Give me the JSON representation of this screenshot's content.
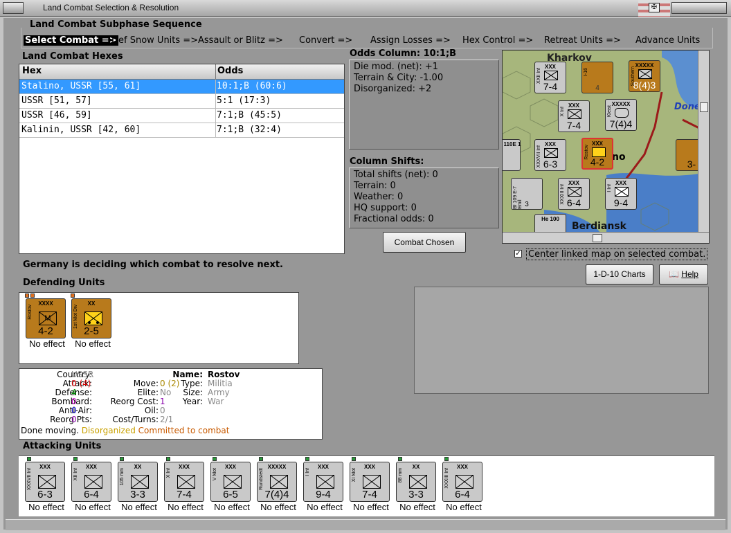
{
  "window": {
    "title": "Land Combat Selection & Resolution"
  },
  "sequence": {
    "header": "Land Combat Subphase Sequence",
    "steps": [
      "Select Combat =>",
      "Def Snow Units =>",
      "Assault or Blitz =>",
      "Convert =>",
      "Assign Losses =>",
      "Hex Control =>",
      "Retreat Units =>",
      "Advance Units"
    ]
  },
  "hexes": {
    "header": "Land Combat Hexes",
    "columns": [
      "Hex",
      "Odds"
    ],
    "rows": [
      {
        "hex": "Stalino, USSR [55, 61]",
        "odds": "10:1;B (60:6)"
      },
      {
        "hex": "USSR [51, 57]",
        "odds": "5:1 (17:3)"
      },
      {
        "hex": "USSR [46, 59]",
        "odds": "7:1;B (45:5)"
      },
      {
        "hex": "Kalinin, USSR [42, 60]",
        "odds": "7:1;B (32:4)"
      }
    ]
  },
  "odds": {
    "header": "Odds Column: 10:1;B",
    "lines": [
      "Die mod. (net): +1",
      "Terrain & City: -1.00",
      "Disorganized: +2"
    ]
  },
  "shifts": {
    "header": "Column Shifts:",
    "lines": [
      "Total shifts (net): 0",
      "Terrain: 0",
      "Weather: 0",
      "HQ support: 0",
      "Fractional odds: 0"
    ]
  },
  "buttons": {
    "combat_chosen": "Combat Chosen",
    "charts": "1-D-10 Charts",
    "help": "Help"
  },
  "center_map": {
    "label": "Center linked map on selected combat.",
    "checked": true
  },
  "status_message": "Germany is deciding which combat to resolve next.",
  "map": {
    "labels": {
      "kharkov": "Kharkov",
      "done": "Done",
      "no": "no",
      "berdiansk": "Berdiansk"
    },
    "counters": [
      {
        "size": "XXX",
        "name": "XXII Inf",
        "str": "7-4",
        "side": "g"
      },
      {
        "size": "",
        "name": "I-16",
        "str": "4",
        "side": "s"
      },
      {
        "size": "XXXXX",
        "name": "Southern",
        "str": "8(4)3",
        "side": "s"
      },
      {
        "size": "XXX",
        "name": "X Inf",
        "str": "7-4",
        "side": "g"
      },
      {
        "size": "XXXXX",
        "name": "Kleist",
        "str": "7(4)4",
        "side": "g"
      },
      {
        "size": "XXX",
        "name": "XXXVII Inf",
        "str": "6-3",
        "side": "g"
      },
      {
        "size": "XXX",
        "name": "Rostov",
        "str": "4-2",
        "side": "s"
      },
      {
        "size": "XXX",
        "name": "XXXIII Inf",
        "str": "6-4",
        "side": "g"
      },
      {
        "size": "XXX",
        "name": "I Inf",
        "str": "9-4",
        "side": "g"
      },
      {
        "size": "",
        "name": "Bf 109 E-7 Emil",
        "str": "3",
        "side": "g"
      },
      {
        "size": "",
        "name": "He 100",
        "str": "",
        "side": "g"
      },
      {
        "size": "",
        "name": "110E 1",
        "str": "",
        "side": "g"
      },
      {
        "size": "",
        "name": "",
        "str": "3-",
        "side": "s"
      }
    ]
  },
  "defending": {
    "header": "Defending Units",
    "units": [
      {
        "size": "XXXX",
        "name": "Rostov",
        "str": "4-2",
        "symbol": "M",
        "effect": "No effect"
      },
      {
        "size": "XX",
        "name": "1st Mot Div",
        "str": "2-5",
        "symbol": "",
        "effect": "No effect"
      }
    ]
  },
  "info": {
    "country_label": "Country:",
    "country": "USSR",
    "attack_label": "Attack:",
    "attack": "0",
    "attack_paren": "(4)",
    "defense_label": "Defense:",
    "defense": "4",
    "bombard_label": "Bombard:",
    "bombard": "0",
    "antiair_label": "Anti-Air:",
    "antiair": "0",
    "reorg_label": "Reorg Pts:",
    "reorg": "0",
    "name_label": "Name:",
    "name": "Rostov",
    "move_label": "Move:",
    "move": "0",
    "move_paren": "(2)",
    "type_label": "Type:",
    "type": "Militia",
    "elite_label": "Elite:",
    "elite": "No",
    "size_label": "Size:",
    "size": "Army",
    "reorgcost_label": "Reorg Cost:",
    "reorgcost": "1",
    "year_label": "Year:",
    "year": "War",
    "oil_label": "Oil:",
    "oil": "0",
    "costturns_label": "Cost/Turns:",
    "costturns": "2/1",
    "status_done": "Done moving.",
    "status_dis": "Disorganized",
    "status_comm": "Committed to combat"
  },
  "attacking": {
    "header": "Attacking Units",
    "units": [
      {
        "size": "XXX",
        "name": "XXXVII Inf",
        "str": "6-3",
        "effect": "No effect"
      },
      {
        "size": "XXX",
        "name": "XII Inf",
        "str": "6-4",
        "effect": "No effect"
      },
      {
        "size": "XX",
        "name": "105 mm",
        "str": "3-3",
        "effect": "No effect"
      },
      {
        "size": "XXX",
        "name": "X Inf",
        "str": "7-4",
        "effect": "No effect"
      },
      {
        "size": "XXX",
        "name": "V Mot",
        "str": "6-5",
        "effect": "No effect"
      },
      {
        "size": "XXXXX",
        "name": "Rundstedt",
        "str": "7(4)4",
        "effect": "No effect"
      },
      {
        "size": "XXX",
        "name": "I Inf",
        "str": "9-4",
        "effect": "No effect"
      },
      {
        "size": "XXX",
        "name": "XI Mot",
        "str": "7-4",
        "effect": "No effect"
      },
      {
        "size": "XX",
        "name": "88 mm",
        "str": "3-3",
        "effect": "No effect"
      },
      {
        "size": "XXX",
        "name": "XXXIII Inf",
        "str": "6-4",
        "effect": "No effect"
      }
    ]
  },
  "colors": {
    "selection": "#3399ff",
    "soviet": "#b87a1c",
    "german": "#c9c9c9",
    "panel_bg": "#979797"
  }
}
